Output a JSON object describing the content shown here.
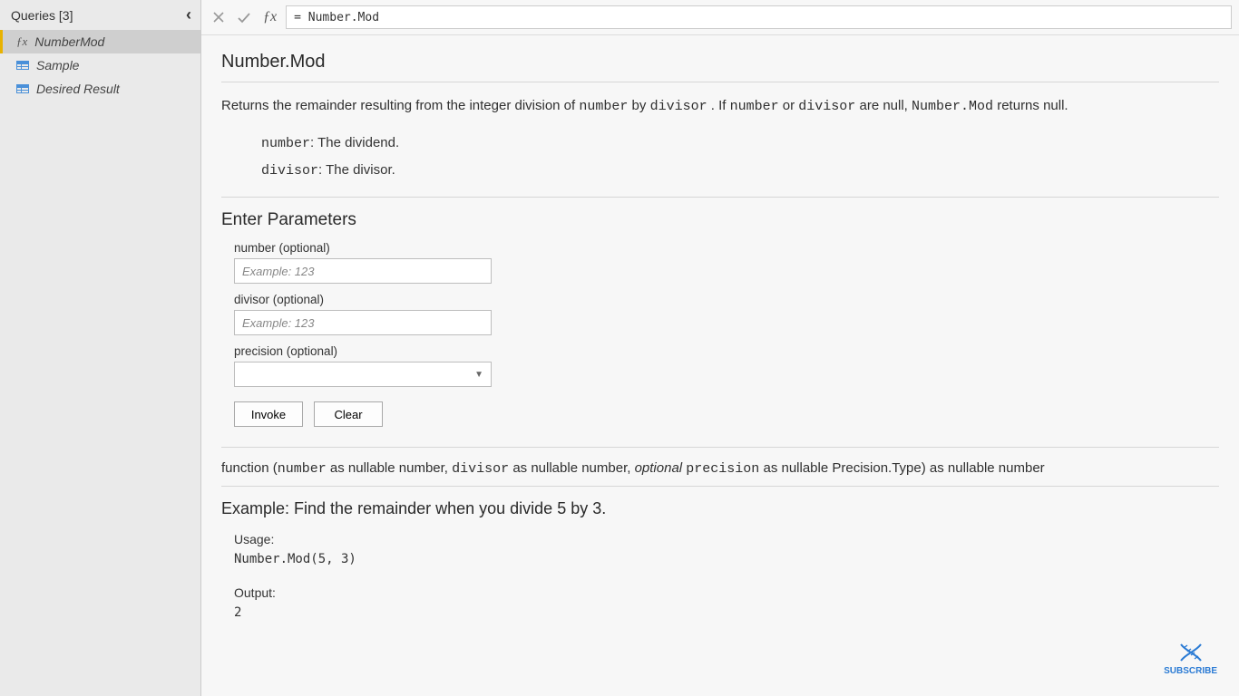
{
  "sidebar": {
    "title": "Queries [3]",
    "items": [
      {
        "label": "NumberMod",
        "icon": "fx",
        "selected": true
      },
      {
        "label": "Sample",
        "icon": "table",
        "selected": false
      },
      {
        "label": "Desired Result",
        "icon": "table",
        "selected": false
      }
    ]
  },
  "formula_bar": {
    "value": "= Number.Mod"
  },
  "doc": {
    "title": "Number.Mod",
    "description_prefix": "Returns the remainder resulting from the integer division of ",
    "description_mid1": " by ",
    "description_mid2": ". If ",
    "description_mid3": " or ",
    "description_mid4": " are null, ",
    "description_suffix": " returns null.",
    "code_number": "number",
    "code_divisor": "divisor",
    "code_funcname": "Number.Mod",
    "params_defs": [
      {
        "name": "number",
        "desc": ": The dividend."
      },
      {
        "name": "divisor",
        "desc": ": The divisor."
      }
    ],
    "enter_params_title": "Enter Parameters",
    "fields": {
      "number": {
        "label": "number (optional)",
        "placeholder": "Example: 123"
      },
      "divisor": {
        "label": "divisor (optional)",
        "placeholder": "Example: 123"
      },
      "precision": {
        "label": "precision (optional)"
      }
    },
    "buttons": {
      "invoke": "Invoke",
      "clear": "Clear"
    },
    "signature": {
      "prefix": "function (",
      "p1": "number",
      "p1_type": " as nullable number, ",
      "p2": "divisor",
      "p2_type": " as nullable number, ",
      "opt": "optional",
      "p3_space": " ",
      "p3": "precision",
      "p3_type": " as nullable Precision.Type) as nullable number"
    },
    "example": {
      "title": "Example: Find the remainder when you divide 5 by 3.",
      "usage_label": "Usage:",
      "usage_code": "Number.Mod(5, 3)",
      "output_label": "Output:",
      "output_value": "2"
    }
  },
  "subscribe_label": "SUBSCRIBE"
}
